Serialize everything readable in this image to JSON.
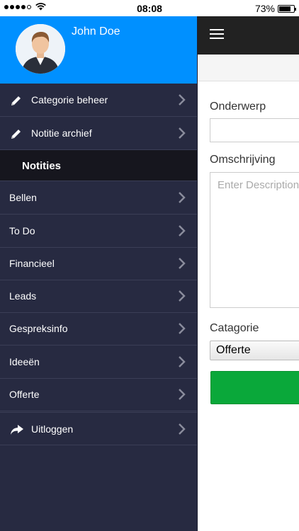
{
  "status_bar": {
    "time": "08:08",
    "battery": "73%",
    "battery_level": 0.73
  },
  "drawer": {
    "user": {
      "name": "John Doe"
    },
    "top_items": [
      {
        "label": "Categorie beheer",
        "icon": "pencil-icon"
      },
      {
        "label": "Notitie archief",
        "icon": "pencil-icon"
      }
    ],
    "section_title": "Notities",
    "note_items": [
      {
        "label": "Bellen"
      },
      {
        "label": "To Do"
      },
      {
        "label": "Financieel"
      },
      {
        "label": "Leads"
      },
      {
        "label": "Gespreksinfo"
      },
      {
        "label": "Ideeën"
      },
      {
        "label": "Offerte"
      }
    ],
    "logout": {
      "label": "Uitloggen",
      "icon": "share-arrow-icon"
    }
  },
  "form": {
    "subject_label": "Onderwerp",
    "subject_value": "",
    "description_label": "Omschrijving",
    "description_placeholder": "Enter Description",
    "category_label": "Catagorie",
    "category_selected": "Offerte"
  },
  "colors": {
    "drawer_bg": "#272a41",
    "profile_bg": "#0090ff",
    "section_bg": "#16161e",
    "topbar_bg": "#222222",
    "submit_green": "#0aa83a"
  }
}
